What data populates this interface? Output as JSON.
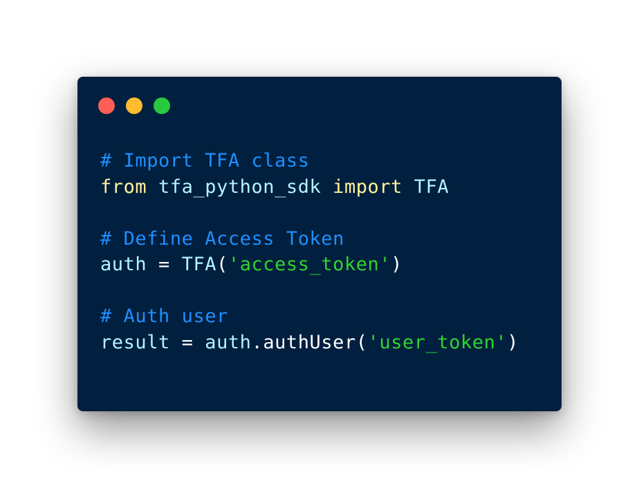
{
  "window": {
    "controls": [
      {
        "name": "close",
        "color": "#ff5f56"
      },
      {
        "name": "minimize",
        "color": "#ffbd2e"
      },
      {
        "name": "maximize",
        "color": "#27c93f"
      }
    ]
  },
  "colors": {
    "background": "#011f3f",
    "comment": "#1e90ff",
    "keyword": "#fff59a",
    "identifier": "#b2f5ff",
    "string": "#2ed62e",
    "plain": "#ffffff"
  },
  "code": {
    "language": "python",
    "lines": [
      {
        "tokens": [
          {
            "text": "# Import TFA class",
            "kind": "comment"
          }
        ]
      },
      {
        "tokens": [
          {
            "text": "from",
            "kind": "keyword"
          },
          {
            "text": " ",
            "kind": "plain"
          },
          {
            "text": "tfa_python_sdk",
            "kind": "identifier"
          },
          {
            "text": " ",
            "kind": "plain"
          },
          {
            "text": "import",
            "kind": "keyword"
          },
          {
            "text": " ",
            "kind": "plain"
          },
          {
            "text": "TFA",
            "kind": "identifier"
          }
        ]
      },
      {
        "tokens": []
      },
      {
        "tokens": [
          {
            "text": "# Define Access Token",
            "kind": "comment"
          }
        ]
      },
      {
        "tokens": [
          {
            "text": "auth",
            "kind": "identifier"
          },
          {
            "text": " = ",
            "kind": "plain"
          },
          {
            "text": "TFA",
            "kind": "identifier"
          },
          {
            "text": "(",
            "kind": "plain"
          },
          {
            "text": "'access_token'",
            "kind": "string"
          },
          {
            "text": ")",
            "kind": "plain"
          }
        ]
      },
      {
        "tokens": []
      },
      {
        "tokens": [
          {
            "text": "# Auth user",
            "kind": "comment"
          }
        ]
      },
      {
        "tokens": [
          {
            "text": "result",
            "kind": "identifier"
          },
          {
            "text": " = ",
            "kind": "plain"
          },
          {
            "text": "auth",
            "kind": "identifier"
          },
          {
            "text": ".",
            "kind": "plain"
          },
          {
            "text": "authUser",
            "kind": "plain"
          },
          {
            "text": "(",
            "kind": "plain"
          },
          {
            "text": "'user_token'",
            "kind": "string"
          },
          {
            "text": ")",
            "kind": "plain"
          }
        ]
      }
    ]
  }
}
